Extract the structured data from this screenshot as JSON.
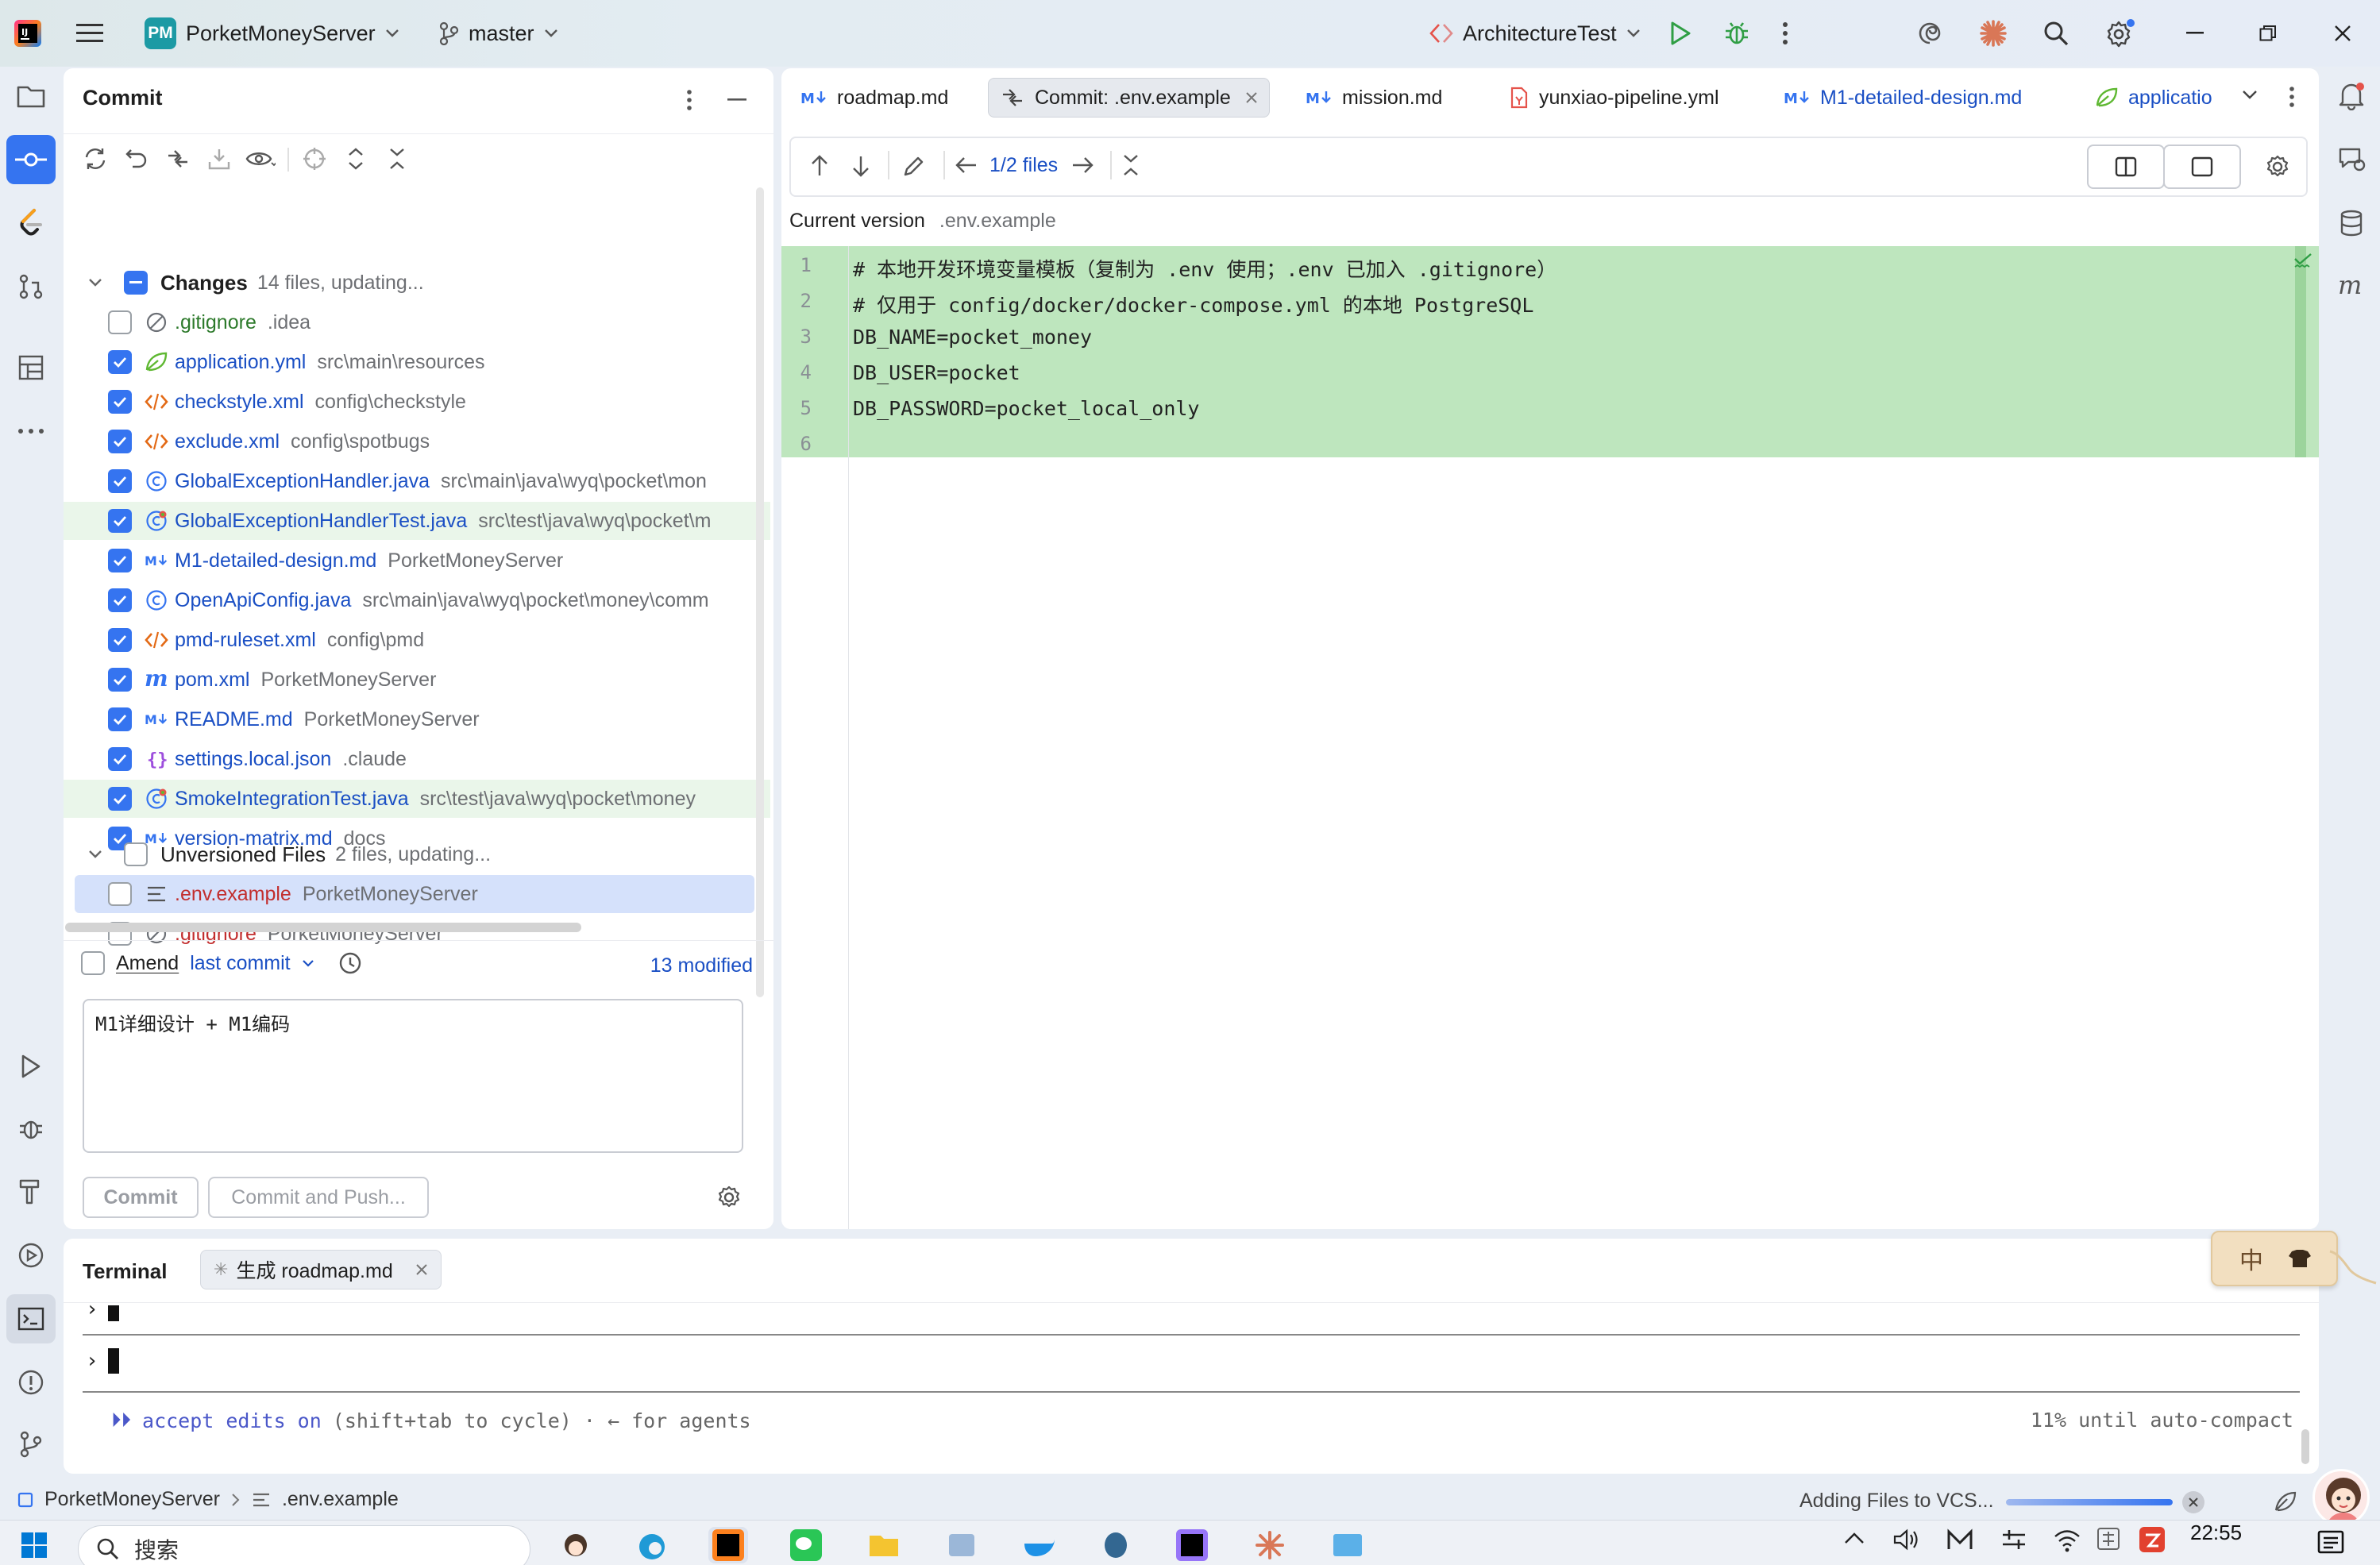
{
  "titlebar": {
    "project_badge": "PM",
    "project_name": "PorketMoneyServer",
    "branch": "master",
    "run_config": "ArchitectureTest"
  },
  "commit_panel": {
    "title": "Commit",
    "changes_label": "Changes",
    "changes_meta": "14 files, updating...",
    "changes": [
      {
        "name": ".gitignore",
        "path": ".idea",
        "checked": false,
        "icon": "ignore-icon",
        "color": "green"
      },
      {
        "name": "application.yml",
        "path": "src\\main\\resources",
        "checked": true,
        "icon": "spring-icon",
        "color": "blue"
      },
      {
        "name": "checkstyle.xml",
        "path": "config\\checkstyle",
        "checked": true,
        "icon": "xml-icon",
        "color": "blue"
      },
      {
        "name": "exclude.xml",
        "path": "config\\spotbugs",
        "checked": true,
        "icon": "xml-icon",
        "color": "blue"
      },
      {
        "name": "GlobalExceptionHandler.java",
        "path": "src\\main\\java\\wyq\\pocket\\mon",
        "checked": true,
        "icon": "java-class-icon",
        "color": "blue"
      },
      {
        "name": "GlobalExceptionHandlerTest.java",
        "path": "src\\test\\java\\wyq\\pocket\\m",
        "checked": true,
        "icon": "java-test-icon",
        "color": "blue"
      },
      {
        "name": "M1-detailed-design.md",
        "path": "PorketMoneyServer",
        "checked": true,
        "icon": "markdown-icon",
        "color": "blue"
      },
      {
        "name": "OpenApiConfig.java",
        "path": "src\\main\\java\\wyq\\pocket\\money\\comm",
        "checked": true,
        "icon": "java-class-icon",
        "color": "blue"
      },
      {
        "name": "pmd-ruleset.xml",
        "path": "config\\pmd",
        "checked": true,
        "icon": "xml-icon",
        "color": "blue"
      },
      {
        "name": "pom.xml",
        "path": "PorketMoneyServer",
        "checked": true,
        "icon": "maven-icon",
        "color": "blue"
      },
      {
        "name": "README.md",
        "path": "PorketMoneyServer",
        "checked": true,
        "icon": "markdown-icon",
        "color": "blue"
      },
      {
        "name": "settings.local.json",
        "path": ".claude",
        "checked": true,
        "icon": "json-icon",
        "color": "blue"
      },
      {
        "name": "SmokeIntegrationTest.java",
        "path": "src\\test\\java\\wyq\\pocket\\money",
        "checked": true,
        "icon": "java-test-icon",
        "color": "blue"
      },
      {
        "name": "version-matrix.md",
        "path": "docs",
        "checked": true,
        "icon": "markdown-icon",
        "color": "blue"
      }
    ],
    "unversioned_label": "Unversioned Files",
    "unversioned_meta": "2 files, updating...",
    "unversioned": [
      {
        "name": ".env.example",
        "path": "PorketMoneyServer",
        "checked": false,
        "icon": "text-file-icon",
        "color": "red"
      },
      {
        "name": ".gitignore",
        "path": "PorketMoneyServer",
        "checked": false,
        "icon": "ignore-icon",
        "color": "red"
      }
    ],
    "amend_label": "Amend",
    "last_commit": "last commit",
    "modified": "13 modified",
    "message": "M1详细设计 + M1编码",
    "commit_btn": "Commit",
    "commit_push_btn": "Commit and Push..."
  },
  "editor": {
    "tabs": [
      {
        "label": "roadmap.md",
        "icon": "markdown-icon"
      },
      {
        "label": "Commit: .env.example",
        "icon": "diff-icon",
        "active": true
      },
      {
        "label": "mission.md",
        "icon": "markdown-icon"
      },
      {
        "label": "yunxiao-pipeline.yml",
        "icon": "yaml-icon"
      },
      {
        "label": "M1-detailed-design.md",
        "icon": "markdown-icon"
      },
      {
        "label": "applicatio",
        "icon": "spring-icon"
      }
    ],
    "files_counter": "1/2 files",
    "current_version": "Current version",
    "current_file": ".env.example",
    "lines": [
      {
        "n": "1",
        "text": "# 本地开发环境变量模板（复制为 .env 使用；.env 已加入 .gitignore）"
      },
      {
        "n": "2",
        "text": "# 仅用于 config/docker/docker-compose.yml 的本地 PostgreSQL"
      },
      {
        "n": "3",
        "text": "DB_NAME=pocket_money"
      },
      {
        "n": "4",
        "text": "DB_USER=pocket"
      },
      {
        "n": "5",
        "text": "DB_PASSWORD=pocket_local_only"
      },
      {
        "n": "6",
        "text": ""
      }
    ]
  },
  "terminal": {
    "title": "Terminal",
    "tab": "生成 roadmap.md",
    "prompt_partial": "›",
    "prompt": "›",
    "mode_arrows": "⏵⏵",
    "mode_text": "accept edits on",
    "mode_hint": "(shift+tab to cycle) · ← for agents",
    "compact": "11% until auto-compact"
  },
  "statusbar": {
    "project": "PorketMoneyServer",
    "file": ".env.example",
    "progress_text": "Adding Files to VCS...",
    "progress": 1.0
  },
  "ime": {
    "mode": "中"
  },
  "taskbar": {
    "search_placeholder": "搜索",
    "clock": "22:55"
  },
  "colors": {
    "accent": "#3574f0",
    "added_bg": "#bee6be",
    "selected_row": "#d5e1fb"
  }
}
